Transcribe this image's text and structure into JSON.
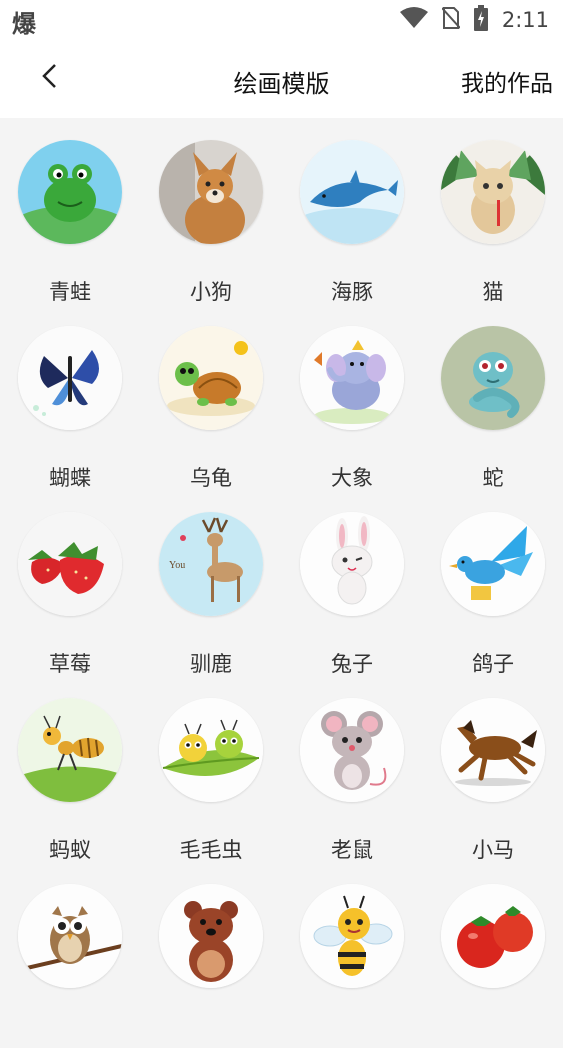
{
  "status_bar": {
    "left_glyph": "爆",
    "time": "2:11",
    "icons": [
      "wifi-icon",
      "no-sim-icon",
      "battery-charging-icon"
    ]
  },
  "header": {
    "back_icon": "chevron-left-icon",
    "title": "绘画模版",
    "my_works_label": "我的作品"
  },
  "templates": [
    {
      "label": "青蛙",
      "icon": "frog-icon"
    },
    {
      "label": "小狗",
      "icon": "dog-icon"
    },
    {
      "label": "海豚",
      "icon": "dolphin-icon"
    },
    {
      "label": "猫",
      "icon": "cat-icon"
    },
    {
      "label": "蝴蝶",
      "icon": "butterfly-icon"
    },
    {
      "label": "乌龟",
      "icon": "turtle-icon"
    },
    {
      "label": "大象",
      "icon": "elephant-icon"
    },
    {
      "label": "蛇",
      "icon": "snake-icon"
    },
    {
      "label": "草莓",
      "icon": "strawberry-icon"
    },
    {
      "label": "驯鹿",
      "icon": "reindeer-icon"
    },
    {
      "label": "兔子",
      "icon": "rabbit-icon"
    },
    {
      "label": "鸽子",
      "icon": "pigeon-icon"
    },
    {
      "label": "蚂蚁",
      "icon": "ant-icon"
    },
    {
      "label": "毛毛虫",
      "icon": "caterpillar-icon"
    },
    {
      "label": "老鼠",
      "icon": "mouse-icon"
    },
    {
      "label": "小马",
      "icon": "horse-icon"
    },
    {
      "label": "",
      "icon": "owl-icon"
    },
    {
      "label": "",
      "icon": "bear-icon"
    },
    {
      "label": "",
      "icon": "bee-icon"
    },
    {
      "label": "",
      "icon": "tomato-icon"
    }
  ]
}
